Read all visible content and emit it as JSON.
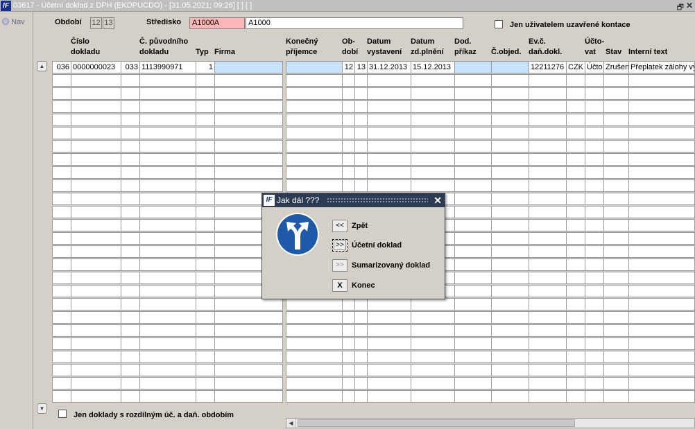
{
  "window": {
    "title": "03617 - Účetní doklad z DPH (EKDPUCDO) - [31.05.2021; 09:26]  [ ]  [ ]",
    "app_icon": "IF",
    "restore_glyph": "🗗",
    "close_glyph": "✕"
  },
  "nav": {
    "label": "Nav"
  },
  "filters": {
    "obdobi_label": "Období",
    "obdobi_from": "12",
    "obdobi_to": "13",
    "stredisko_label": "Středisko",
    "stredisko_code": "A1000A",
    "stredisko_name": "A1000",
    "closed_by_user_label": "Jen uživatelem uzavřené kontace"
  },
  "columns": [
    {
      "line1": "Číslo",
      "line2": "dokladu"
    },
    {
      "line1": "Č. původního",
      "line2": "dokladu"
    },
    {
      "line1": "",
      "line2": "Typ"
    },
    {
      "line1": "",
      "line2": "Firma"
    },
    {
      "line1": "Konečný",
      "line2": "příjemce"
    },
    {
      "line1": "Ob-",
      "line2": "dobí"
    },
    {
      "line1": "Datum",
      "line2": "vystavení"
    },
    {
      "line1": "Datum",
      "line2": "zd.plnění"
    },
    {
      "line1": "Dod.",
      "line2": "příkaz"
    },
    {
      "line1": "",
      "line2": "Č.objed."
    },
    {
      "line1": "Ev.č.",
      "line2": "daň.dokl."
    },
    {
      "line1": "Účto-",
      "line2": "vat"
    },
    {
      "line1": "",
      "line2": "Stav"
    },
    {
      "line1": "",
      "line2": "Interní text"
    }
  ],
  "rows": [
    [
      "036",
      "0000000023",
      "033",
      "1113990971",
      "1",
      "",
      "",
      "12",
      "13",
      "31.12.2013",
      "15.12.2013",
      "",
      "",
      "12211276",
      "CZK",
      "Účto",
      "Zrušen",
      "Přeplatek zálohy vy"
    ]
  ],
  "bottom": {
    "diff_period_label": "Jen doklady s rozdílným úč. a daň. obdobím"
  },
  "dialog": {
    "title": "Jak dál ???",
    "icon": "IF",
    "close_glyph": "✕",
    "options": [
      {
        "button": "<<",
        "label": "Zpět"
      },
      {
        "button": ">>",
        "label": "Účetní doklad"
      },
      {
        "button": ">>",
        "label": "Sumarizovaný doklad"
      },
      {
        "button": "X",
        "label": "Konec"
      }
    ]
  },
  "colors": {
    "selected_row": "#c8e2fc",
    "stredisko_highlight": "#ffb6b6",
    "dialog_titlebar": "#2c3a52",
    "sign_blue": "#1f5aa8"
  }
}
